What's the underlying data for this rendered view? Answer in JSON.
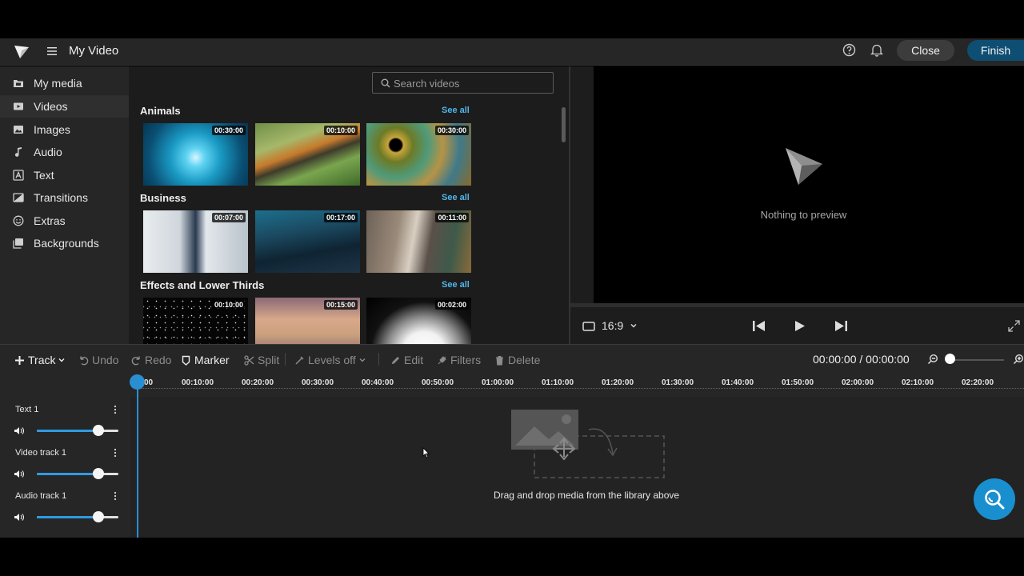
{
  "header": {
    "title": "My Video",
    "close_label": "Close",
    "finish_label": "Finish"
  },
  "sidebar": {
    "items": [
      {
        "label": "My media",
        "icon": "folder-icon"
      },
      {
        "label": "Videos",
        "icon": "video-icon",
        "active": true
      },
      {
        "label": "Images",
        "icon": "image-icon"
      },
      {
        "label": "Audio",
        "icon": "music-note-icon"
      },
      {
        "label": "Text",
        "icon": "text-icon"
      },
      {
        "label": "Transitions",
        "icon": "transition-icon"
      },
      {
        "label": "Extras",
        "icon": "smiley-icon"
      },
      {
        "label": "Backgrounds",
        "icon": "backgrounds-icon"
      }
    ]
  },
  "library": {
    "search_placeholder": "Search videos",
    "see_all_label": "See all",
    "categories": [
      {
        "title": "Animals",
        "durations": [
          "00:30:00",
          "00:10:00",
          "00:30:00"
        ]
      },
      {
        "title": "Business",
        "durations": [
          "00:07:00",
          "00:17:00",
          "00:11:00"
        ]
      },
      {
        "title": "Effects and Lower Thirds",
        "durations": [
          "00:10:00",
          "00:15:00",
          "00:02:00"
        ]
      }
    ]
  },
  "preview": {
    "empty_text": "Nothing to preview",
    "aspect_ratio": "16:9"
  },
  "toolbar": {
    "track": "Track",
    "undo": "Undo",
    "redo": "Redo",
    "marker": "Marker",
    "split": "Split",
    "levels": "Levels off",
    "edit": "Edit",
    "filters": "Filters",
    "delete": "Delete",
    "time": "00:00:00 / 00:00:00"
  },
  "ruler": {
    "labels": [
      "00",
      "00:10:00",
      "00:20:00",
      "00:30:00",
      "00:40:00",
      "00:50:00",
      "01:00:00",
      "01:10:00",
      "01:20:00",
      "01:30:00",
      "01:40:00",
      "01:50:00",
      "02:00:00",
      "02:10:00",
      "02:20:00"
    ]
  },
  "tracks": [
    {
      "name": "Text 1",
      "volume": 0.75
    },
    {
      "name": "Video track 1",
      "volume": 0.75
    },
    {
      "name": "Audio track 1",
      "volume": 0.75
    }
  ],
  "timeline": {
    "drop_text": "Drag and drop media from the library above"
  },
  "colors": {
    "accent": "#2a8fd0",
    "finish": "#0e4e73",
    "see_all": "#4fb6ea"
  }
}
